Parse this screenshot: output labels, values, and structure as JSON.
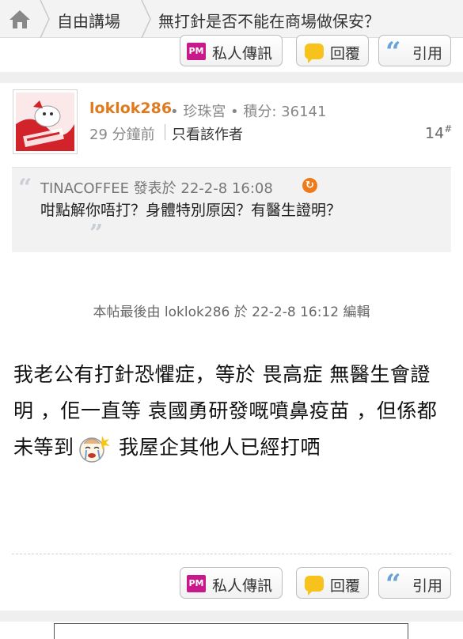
{
  "breadcrumb": {
    "home_icon": "home-icon",
    "items": [
      "自由講場",
      "無打針是否不能在商場做保安？"
    ]
  },
  "actions": {
    "pm": "私人傳訊",
    "pm_badge": "PM",
    "reply": "回覆",
    "quote": "引用"
  },
  "post": {
    "username": "loklok286",
    "rank": "• 珍珠宮 • 積分: 36141",
    "time": "29 分鐘前",
    "only_author": "只看該作者",
    "floor": "14",
    "floor_mark": "#",
    "quote": {
      "header": "TINACOFFEE 發表於 22-2-8 16:08",
      "body": "咁點解你唔打？身體特別原因？有醫生證明？"
    },
    "edited": "本帖最後由 loklok286 於 22-2-8 16:12 編輯",
    "content_before": "我老公有打針恐懼症，等於 畏高症 無醫生會證明 ，佢一直等 袁國勇研發嘅噴鼻疫苗 ，但係都未等到",
    "content_after": " 我屋企其他人已經打哂"
  },
  "colors": {
    "username": "#e07a1f",
    "pm_badge": "#c8198a",
    "reply_icon": "#f7c21b",
    "quote_icon": "#6aa2d8"
  }
}
